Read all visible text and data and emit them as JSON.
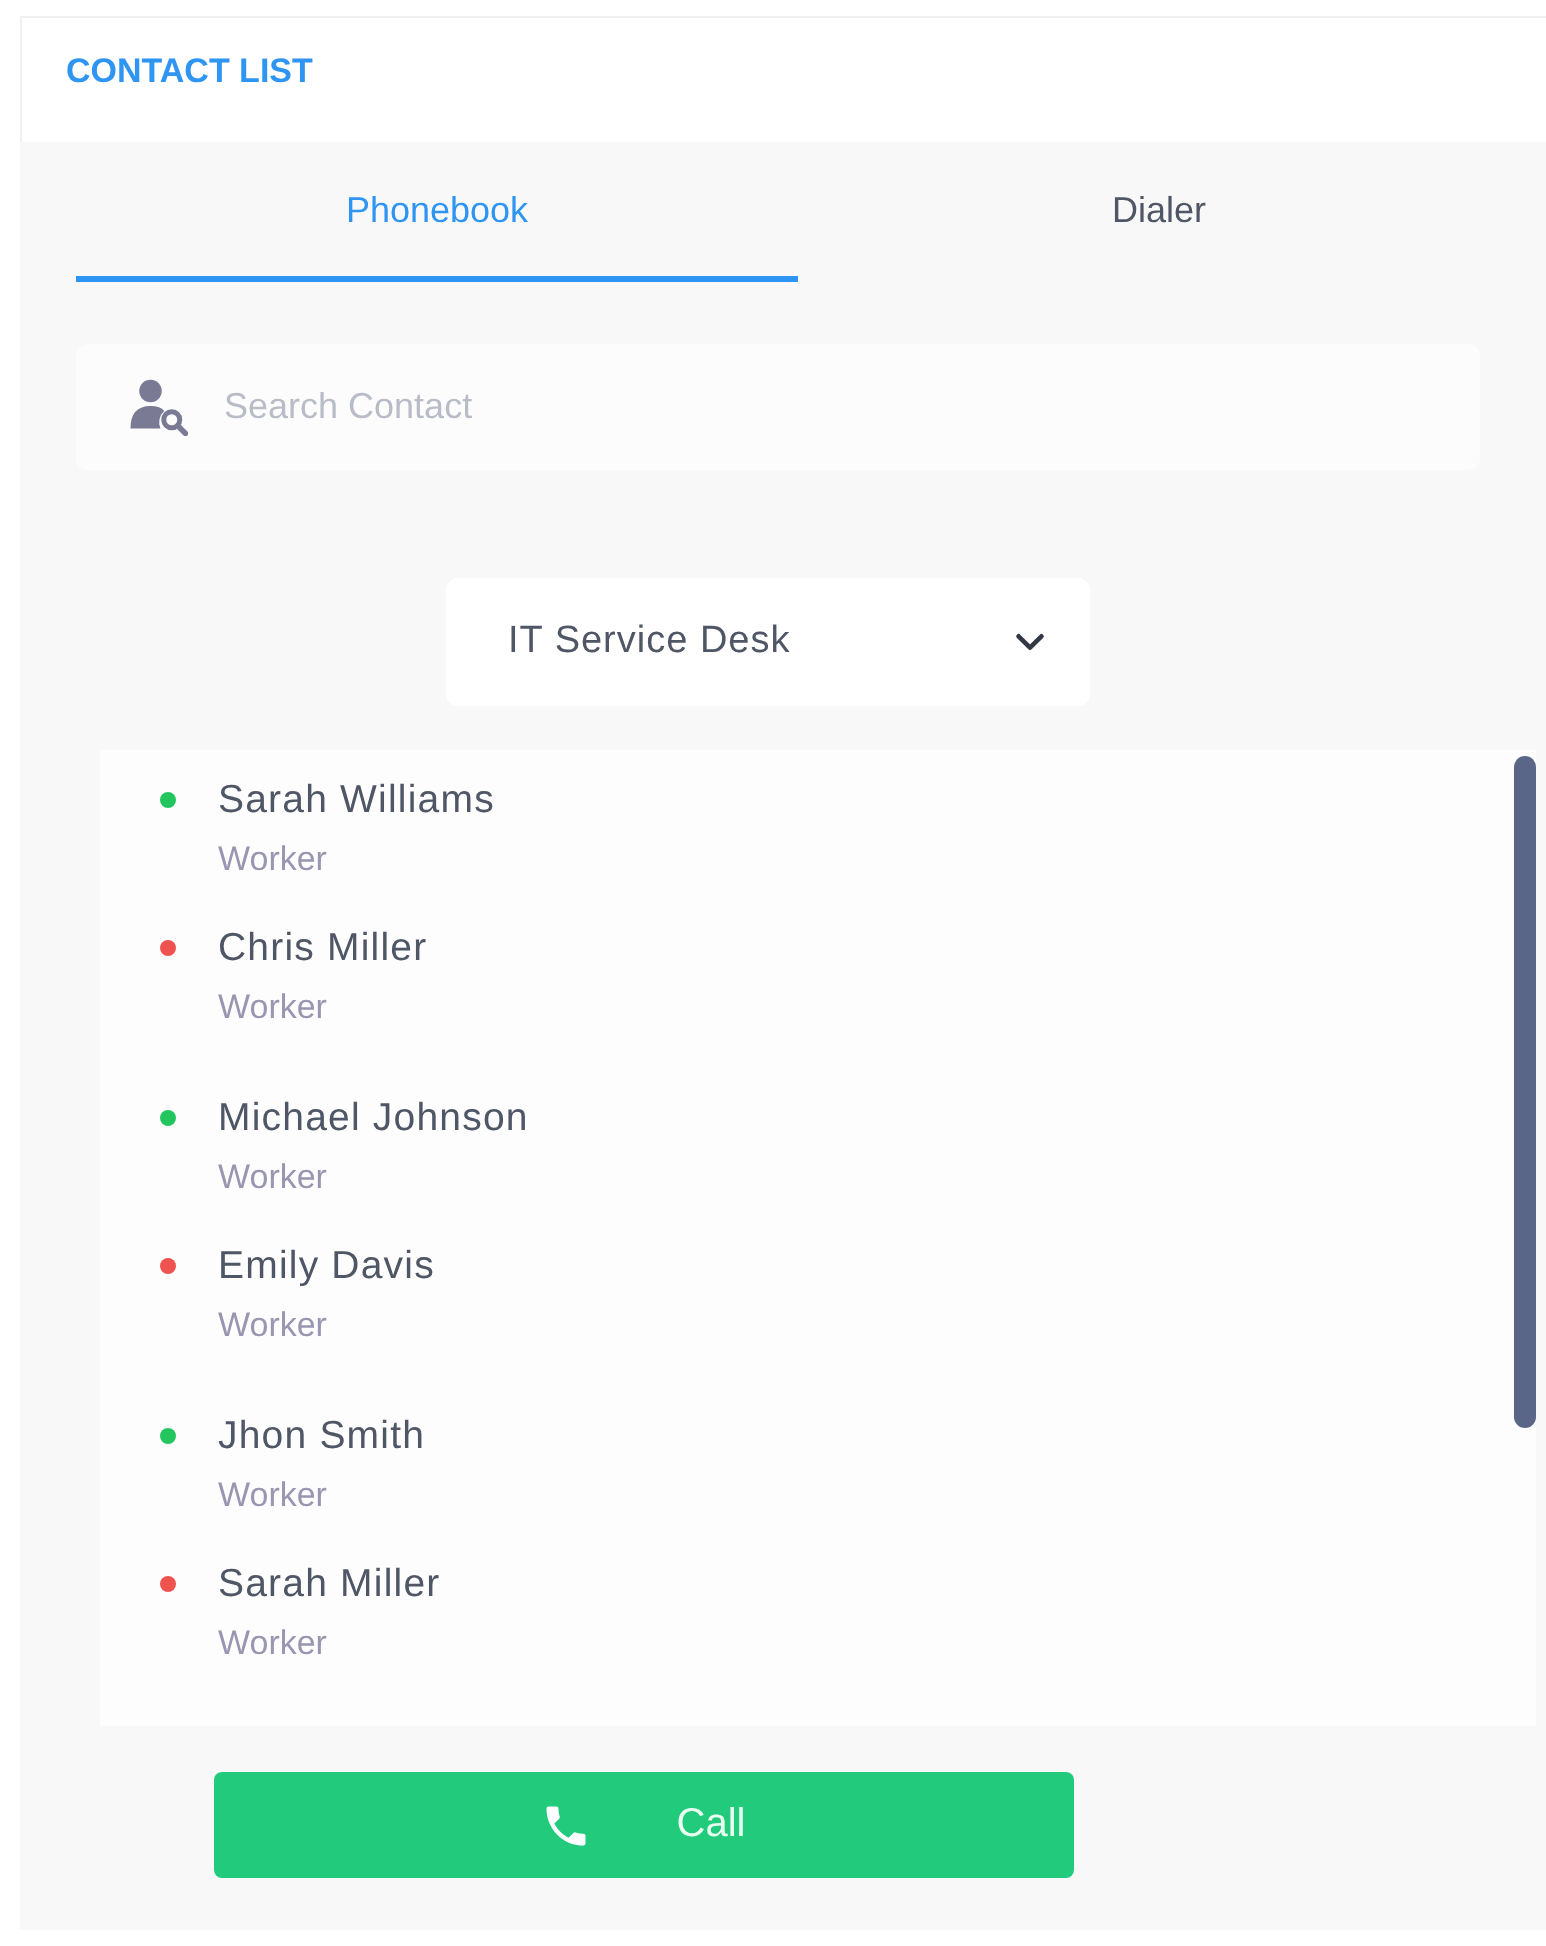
{
  "header": {
    "title": "CONTACT LIST"
  },
  "tabs": [
    {
      "label": "Phonebook",
      "selected": true
    },
    {
      "label": "Dialer",
      "selected": false
    }
  ],
  "search": {
    "placeholder": "Search Contact"
  },
  "department": {
    "value": "IT Service Desk"
  },
  "contacts": [
    {
      "name": "Sarah Williams",
      "role": "Worker",
      "color": "#22c55e"
    },
    {
      "name": "Chris Miller",
      "role": "Worker",
      "color": "#ef5350"
    },
    {
      "name": "Michael Johnson",
      "role": "Worker",
      "color": "#22c55e"
    },
    {
      "name": "Emily Davis",
      "role": "Worker",
      "color": "#ef5350"
    },
    {
      "name": "Jhon Smith",
      "role": "Worker",
      "color": "#22c55e"
    },
    {
      "name": "Sarah Miller",
      "role": "Worker",
      "color": "#ef5350"
    }
  ],
  "call_button": {
    "label": "Call"
  }
}
